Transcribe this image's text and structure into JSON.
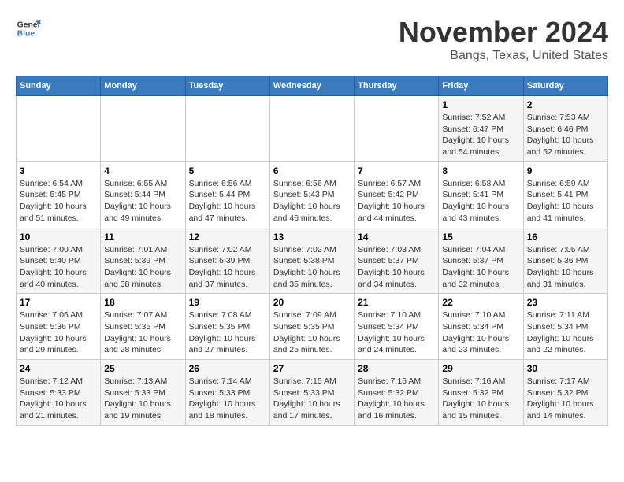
{
  "logo": {
    "line1": "General",
    "line2": "Blue"
  },
  "title": "November 2024",
  "location": "Bangs, Texas, United States",
  "weekdays": [
    "Sunday",
    "Monday",
    "Tuesday",
    "Wednesday",
    "Thursday",
    "Friday",
    "Saturday"
  ],
  "weeks": [
    [
      {
        "day": "",
        "info": ""
      },
      {
        "day": "",
        "info": ""
      },
      {
        "day": "",
        "info": ""
      },
      {
        "day": "",
        "info": ""
      },
      {
        "day": "",
        "info": ""
      },
      {
        "day": "1",
        "info": "Sunrise: 7:52 AM\nSunset: 6:47 PM\nDaylight: 10 hours\nand 54 minutes."
      },
      {
        "day": "2",
        "info": "Sunrise: 7:53 AM\nSunset: 6:46 PM\nDaylight: 10 hours\nand 52 minutes."
      }
    ],
    [
      {
        "day": "3",
        "info": "Sunrise: 6:54 AM\nSunset: 5:45 PM\nDaylight: 10 hours\nand 51 minutes."
      },
      {
        "day": "4",
        "info": "Sunrise: 6:55 AM\nSunset: 5:44 PM\nDaylight: 10 hours\nand 49 minutes."
      },
      {
        "day": "5",
        "info": "Sunrise: 6:56 AM\nSunset: 5:44 PM\nDaylight: 10 hours\nand 47 minutes."
      },
      {
        "day": "6",
        "info": "Sunrise: 6:56 AM\nSunset: 5:43 PM\nDaylight: 10 hours\nand 46 minutes."
      },
      {
        "day": "7",
        "info": "Sunrise: 6:57 AM\nSunset: 5:42 PM\nDaylight: 10 hours\nand 44 minutes."
      },
      {
        "day": "8",
        "info": "Sunrise: 6:58 AM\nSunset: 5:41 PM\nDaylight: 10 hours\nand 43 minutes."
      },
      {
        "day": "9",
        "info": "Sunrise: 6:59 AM\nSunset: 5:41 PM\nDaylight: 10 hours\nand 41 minutes."
      }
    ],
    [
      {
        "day": "10",
        "info": "Sunrise: 7:00 AM\nSunset: 5:40 PM\nDaylight: 10 hours\nand 40 minutes."
      },
      {
        "day": "11",
        "info": "Sunrise: 7:01 AM\nSunset: 5:39 PM\nDaylight: 10 hours\nand 38 minutes."
      },
      {
        "day": "12",
        "info": "Sunrise: 7:02 AM\nSunset: 5:39 PM\nDaylight: 10 hours\nand 37 minutes."
      },
      {
        "day": "13",
        "info": "Sunrise: 7:02 AM\nSunset: 5:38 PM\nDaylight: 10 hours\nand 35 minutes."
      },
      {
        "day": "14",
        "info": "Sunrise: 7:03 AM\nSunset: 5:37 PM\nDaylight: 10 hours\nand 34 minutes."
      },
      {
        "day": "15",
        "info": "Sunrise: 7:04 AM\nSunset: 5:37 PM\nDaylight: 10 hours\nand 32 minutes."
      },
      {
        "day": "16",
        "info": "Sunrise: 7:05 AM\nSunset: 5:36 PM\nDaylight: 10 hours\nand 31 minutes."
      }
    ],
    [
      {
        "day": "17",
        "info": "Sunrise: 7:06 AM\nSunset: 5:36 PM\nDaylight: 10 hours\nand 29 minutes."
      },
      {
        "day": "18",
        "info": "Sunrise: 7:07 AM\nSunset: 5:35 PM\nDaylight: 10 hours\nand 28 minutes."
      },
      {
        "day": "19",
        "info": "Sunrise: 7:08 AM\nSunset: 5:35 PM\nDaylight: 10 hours\nand 27 minutes."
      },
      {
        "day": "20",
        "info": "Sunrise: 7:09 AM\nSunset: 5:35 PM\nDaylight: 10 hours\nand 25 minutes."
      },
      {
        "day": "21",
        "info": "Sunrise: 7:10 AM\nSunset: 5:34 PM\nDaylight: 10 hours\nand 24 minutes."
      },
      {
        "day": "22",
        "info": "Sunrise: 7:10 AM\nSunset: 5:34 PM\nDaylight: 10 hours\nand 23 minutes."
      },
      {
        "day": "23",
        "info": "Sunrise: 7:11 AM\nSunset: 5:34 PM\nDaylight: 10 hours\nand 22 minutes."
      }
    ],
    [
      {
        "day": "24",
        "info": "Sunrise: 7:12 AM\nSunset: 5:33 PM\nDaylight: 10 hours\nand 21 minutes."
      },
      {
        "day": "25",
        "info": "Sunrise: 7:13 AM\nSunset: 5:33 PM\nDaylight: 10 hours\nand 19 minutes."
      },
      {
        "day": "26",
        "info": "Sunrise: 7:14 AM\nSunset: 5:33 PM\nDaylight: 10 hours\nand 18 minutes."
      },
      {
        "day": "27",
        "info": "Sunrise: 7:15 AM\nSunset: 5:33 PM\nDaylight: 10 hours\nand 17 minutes."
      },
      {
        "day": "28",
        "info": "Sunrise: 7:16 AM\nSunset: 5:32 PM\nDaylight: 10 hours\nand 16 minutes."
      },
      {
        "day": "29",
        "info": "Sunrise: 7:16 AM\nSunset: 5:32 PM\nDaylight: 10 hours\nand 15 minutes."
      },
      {
        "day": "30",
        "info": "Sunrise: 7:17 AM\nSunset: 5:32 PM\nDaylight: 10 hours\nand 14 minutes."
      }
    ]
  ]
}
